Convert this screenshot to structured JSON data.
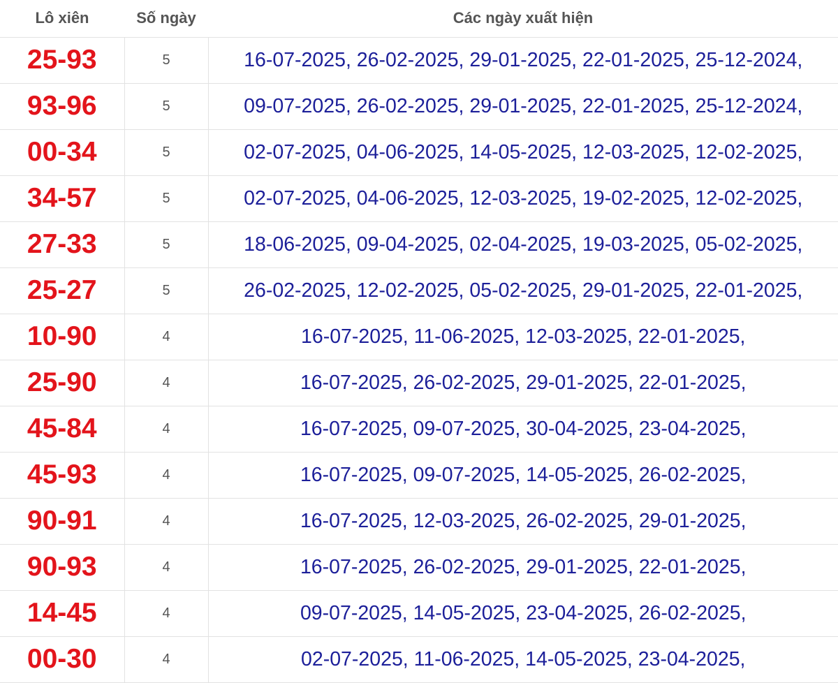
{
  "header": {
    "col_pair": "Lô xiên",
    "col_days": "Số ngày",
    "col_dates": "Các ngày xuất hiện"
  },
  "colors": {
    "pair_text": "#e3141b",
    "dates_text": "#1c1f99",
    "header_text": "#555555",
    "border": "#e2e2e2"
  },
  "rows": [
    {
      "pair": "25-93",
      "days": "5",
      "dates": "16-07-2025, 26-02-2025, 29-01-2025, 22-01-2025, 25-12-2024,"
    },
    {
      "pair": "93-96",
      "days": "5",
      "dates": "09-07-2025, 26-02-2025, 29-01-2025, 22-01-2025, 25-12-2024,"
    },
    {
      "pair": "00-34",
      "days": "5",
      "dates": "02-07-2025, 04-06-2025, 14-05-2025, 12-03-2025, 12-02-2025,"
    },
    {
      "pair": "34-57",
      "days": "5",
      "dates": "02-07-2025, 04-06-2025, 12-03-2025, 19-02-2025, 12-02-2025,"
    },
    {
      "pair": "27-33",
      "days": "5",
      "dates": "18-06-2025, 09-04-2025, 02-04-2025, 19-03-2025, 05-02-2025,"
    },
    {
      "pair": "25-27",
      "days": "5",
      "dates": "26-02-2025, 12-02-2025, 05-02-2025, 29-01-2025, 22-01-2025,"
    },
    {
      "pair": "10-90",
      "days": "4",
      "dates": "16-07-2025, 11-06-2025, 12-03-2025, 22-01-2025,"
    },
    {
      "pair": "25-90",
      "days": "4",
      "dates": "16-07-2025, 26-02-2025, 29-01-2025, 22-01-2025,"
    },
    {
      "pair": "45-84",
      "days": "4",
      "dates": "16-07-2025, 09-07-2025, 30-04-2025, 23-04-2025,"
    },
    {
      "pair": "45-93",
      "days": "4",
      "dates": "16-07-2025, 09-07-2025, 14-05-2025, 26-02-2025,"
    },
    {
      "pair": "90-91",
      "days": "4",
      "dates": "16-07-2025, 12-03-2025, 26-02-2025, 29-01-2025,"
    },
    {
      "pair": "90-93",
      "days": "4",
      "dates": "16-07-2025, 26-02-2025, 29-01-2025, 22-01-2025,"
    },
    {
      "pair": "14-45",
      "days": "4",
      "dates": "09-07-2025, 14-05-2025, 23-04-2025, 26-02-2025,"
    },
    {
      "pair": "00-30",
      "days": "4",
      "dates": "02-07-2025, 11-06-2025, 14-05-2025, 23-04-2025,"
    }
  ]
}
